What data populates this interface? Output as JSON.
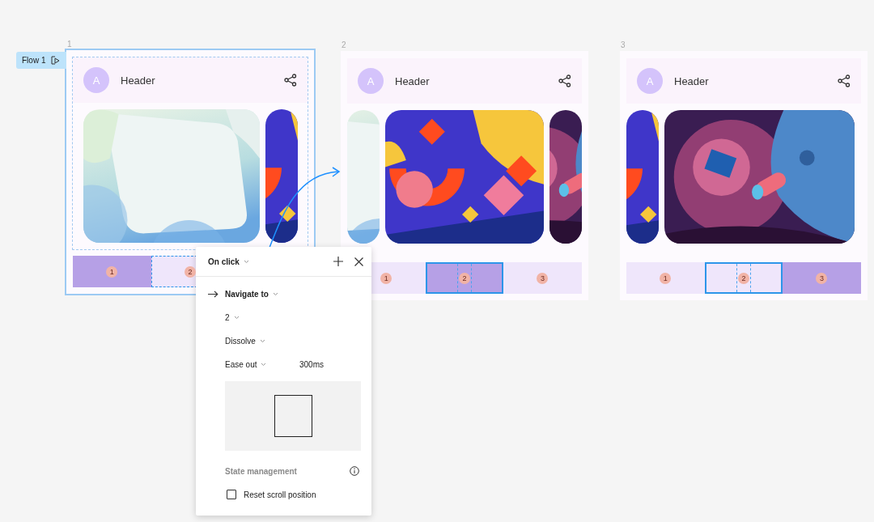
{
  "flow": {
    "label": "Flow 1"
  },
  "frames": [
    {
      "number": "1",
      "selected": true,
      "header": {
        "avatar": "A",
        "title": "Header"
      },
      "tabs": [
        {
          "label": "1",
          "selected": true,
          "outlined": false,
          "hotspot": false
        },
        {
          "label": "2",
          "selected": false,
          "outlined": false,
          "hotspot": true
        }
      ]
    },
    {
      "number": "2",
      "selected": false,
      "header": {
        "avatar": "A",
        "title": "Header"
      },
      "tabs": [
        {
          "label": "1",
          "selected": false,
          "outlined": false,
          "hotspot": false
        },
        {
          "label": "2",
          "selected": true,
          "outlined": true,
          "hotspot": false
        },
        {
          "label": "3",
          "selected": false,
          "outlined": false,
          "hotspot": false
        }
      ]
    },
    {
      "number": "3",
      "selected": false,
      "header": {
        "avatar": "A",
        "title": "Header"
      },
      "tabs": [
        {
          "label": "1",
          "selected": false,
          "outlined": false,
          "hotspot": false
        },
        {
          "label": "2",
          "selected": false,
          "outlined": true,
          "hotspot": false
        },
        {
          "label": "3",
          "selected": true,
          "outlined": false,
          "hotspot": false
        }
      ]
    }
  ],
  "interaction": {
    "trigger": "On click",
    "action": "Navigate to",
    "destination": "2",
    "animation": "Dissolve",
    "easing": "Ease out",
    "duration": "300ms",
    "section": "State management",
    "options": [
      {
        "label": "Reset scroll position",
        "checked": false
      }
    ]
  }
}
